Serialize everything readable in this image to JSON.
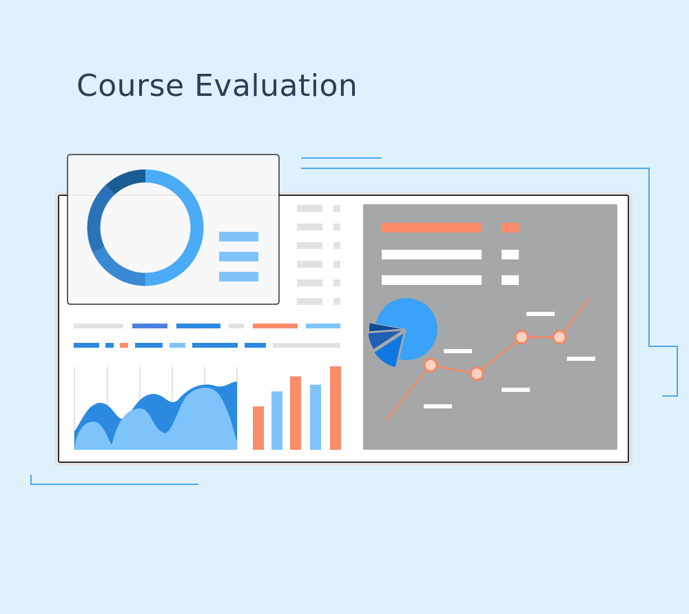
{
  "title": "Course Evaluation",
  "colors": {
    "background": "#dff1fc",
    "title": "#2c3e57",
    "accent_blue": "#2b8ae0",
    "light_blue": "#7ec4fb",
    "orange": "#fb8c69",
    "panel_gray": "#a6a7a8"
  },
  "illustration": {
    "donut_widget": {
      "segments": [
        0.5,
        0.18,
        0.2,
        0.12
      ]
    },
    "bar_chart": {
      "values": [
        0.52,
        0.7,
        0.88,
        0.78,
        1.0
      ]
    },
    "line_chart": {
      "values": [
        0.0,
        0.45,
        0.38,
        0.68,
        0.68,
        1.0
      ]
    },
    "pie_chart": {
      "slices": [
        0.76,
        0.12,
        0.08,
        0.04
      ]
    }
  }
}
